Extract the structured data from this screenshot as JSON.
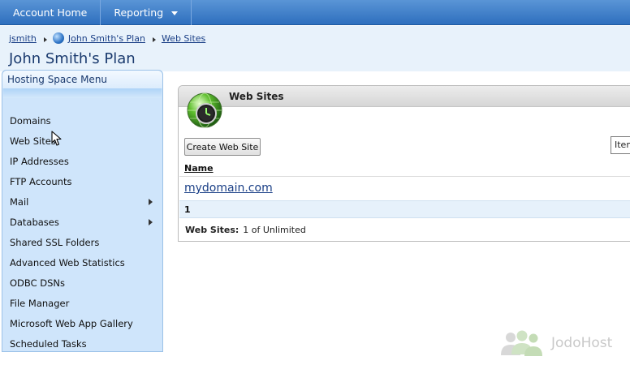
{
  "topnav": {
    "account_home": "Account Home",
    "reporting": "Reporting"
  },
  "breadcrumb": {
    "user": "jsmith",
    "plan": "John Smith's Plan",
    "section": "Web Sites"
  },
  "page_title": "John Smith's Plan",
  "sidebar": {
    "title": "Hosting Space Menu",
    "items": [
      {
        "label": "Domains",
        "submenu": false
      },
      {
        "label": "Web Sites",
        "submenu": false
      },
      {
        "label": "IP Addresses",
        "submenu": false
      },
      {
        "label": "FTP Accounts",
        "submenu": false
      },
      {
        "label": "Mail",
        "submenu": true
      },
      {
        "label": "Databases",
        "submenu": true
      },
      {
        "label": "Shared SSL Folders",
        "submenu": false
      },
      {
        "label": "Advanced Web Statistics",
        "submenu": false
      },
      {
        "label": "ODBC DSNs",
        "submenu": false
      },
      {
        "label": "File Manager",
        "submenu": false
      },
      {
        "label": "Microsoft Web App Gallery",
        "submenu": false
      },
      {
        "label": "Scheduled Tasks",
        "submenu": false
      }
    ]
  },
  "panel": {
    "title": "Web Sites",
    "create_button": "Create Web Site",
    "items_select": "Items",
    "column_name": "Name",
    "rows": [
      "mydomain.com"
    ],
    "page": "1",
    "quota_label": "Web Sites:",
    "quota_value": "1 of Unlimited"
  },
  "watermark": "JodoHost"
}
